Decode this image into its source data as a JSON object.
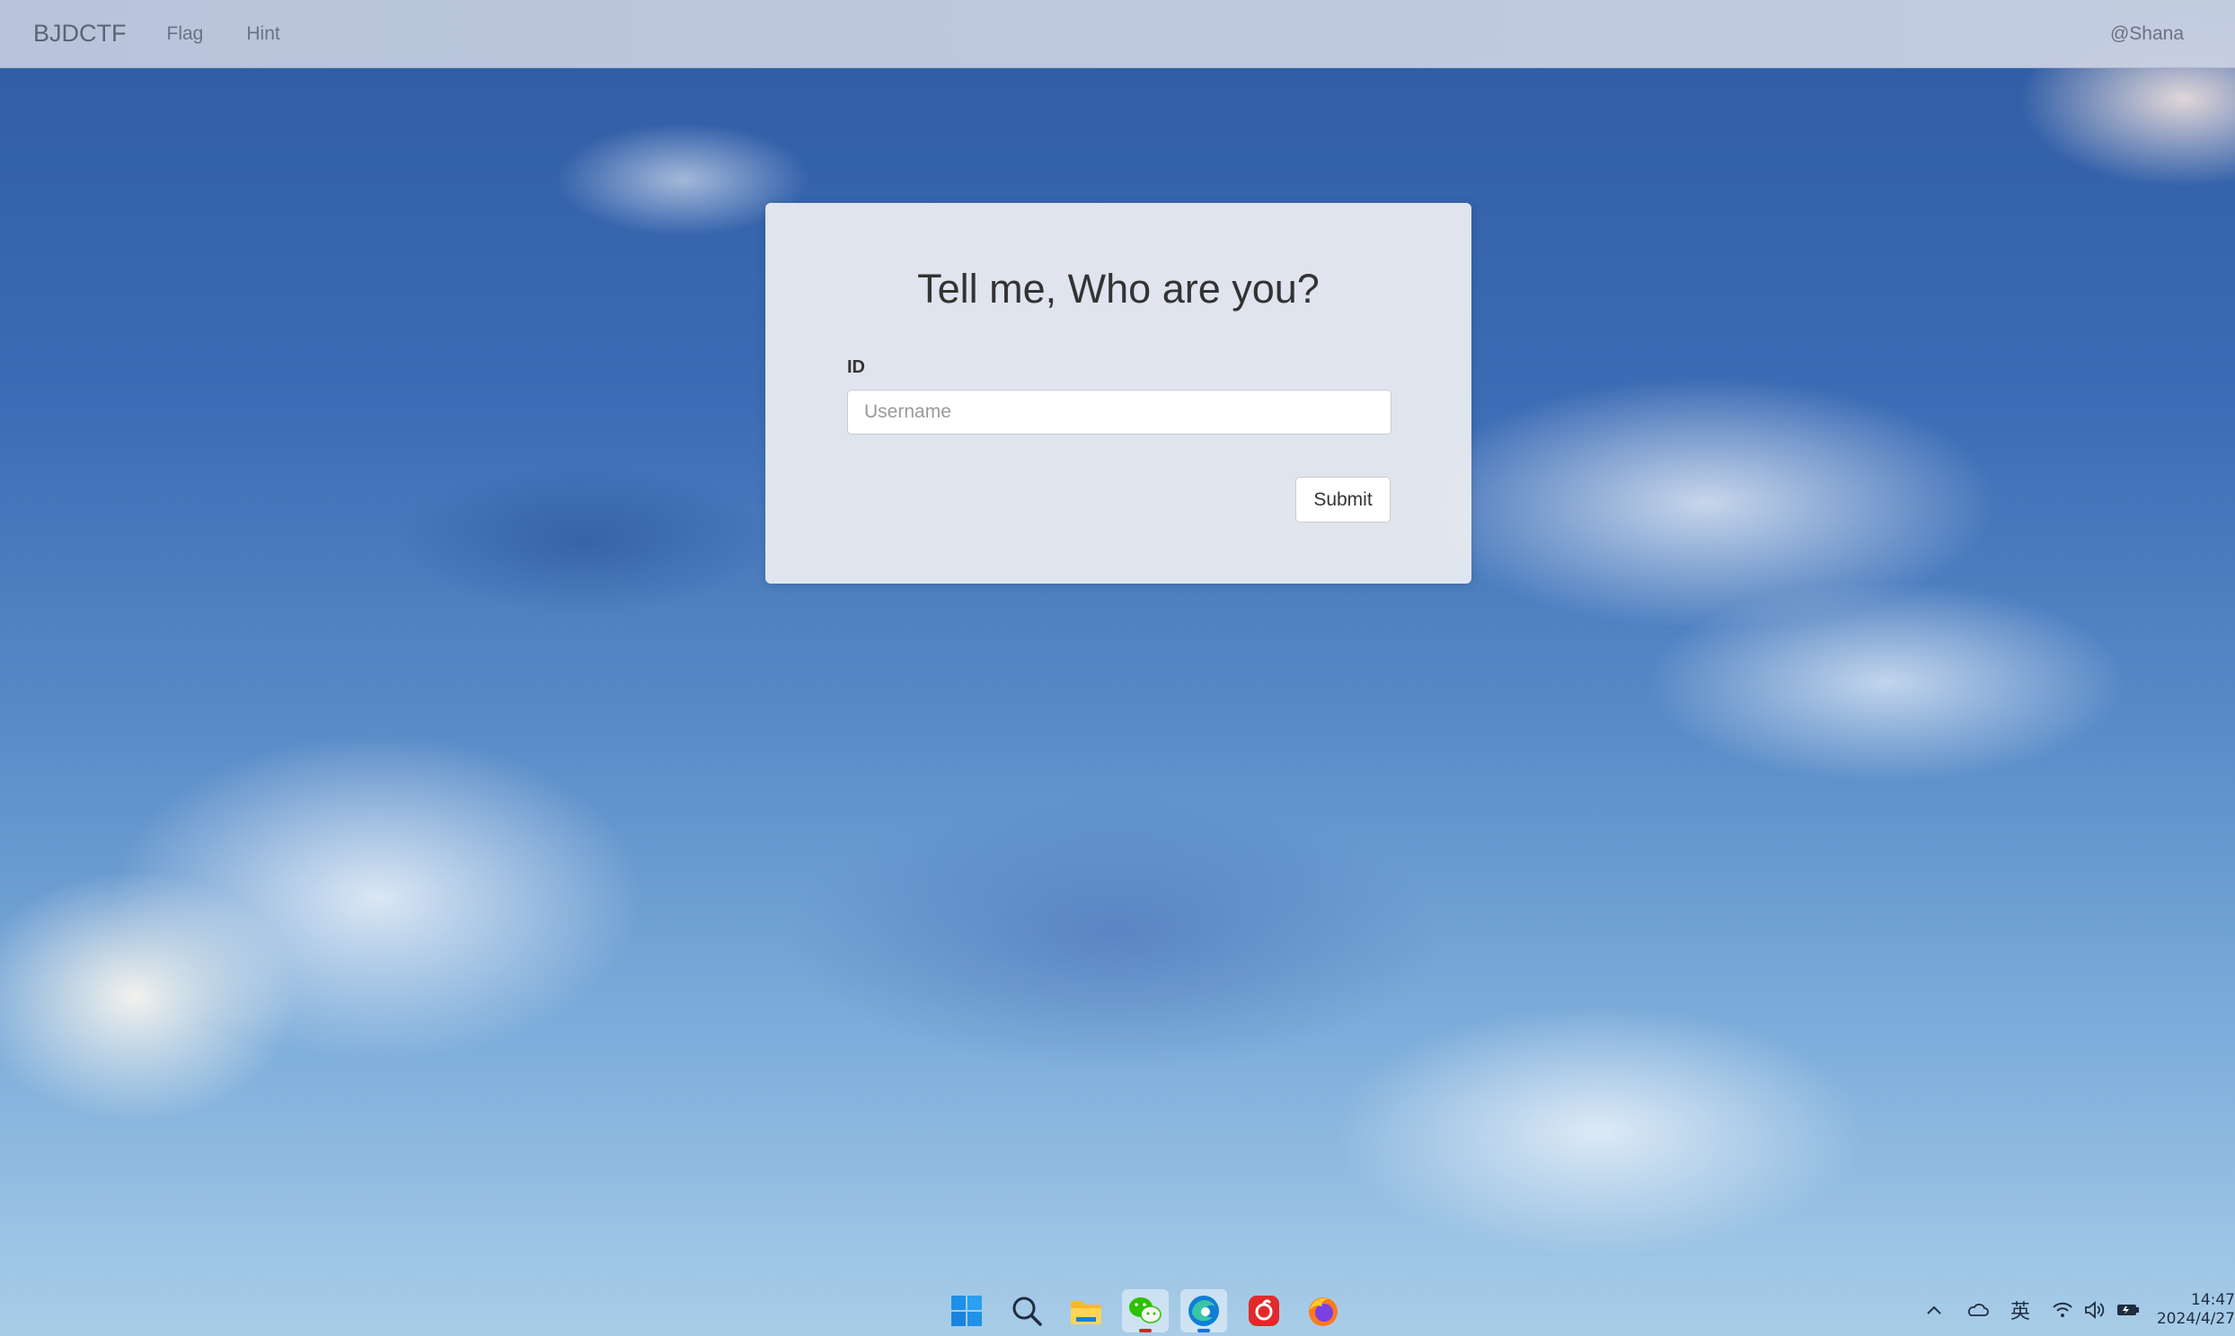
{
  "navbar": {
    "brand": "BJDCTF",
    "links": [
      "Flag",
      "Hint"
    ],
    "user": "@Shana"
  },
  "panel": {
    "title": "Tell me, Who are you?",
    "field_label": "ID",
    "input_placeholder": "Username",
    "input_value": "",
    "submit_label": "Submit"
  },
  "taskbar": {
    "apps": [
      {
        "name": "windows-start-icon"
      },
      {
        "name": "search-icon"
      },
      {
        "name": "file-explorer-icon"
      },
      {
        "name": "wechat-icon",
        "active": true
      },
      {
        "name": "edge-browser-icon",
        "active": true
      },
      {
        "name": "netease-music-icon"
      },
      {
        "name": "firefox-icon"
      }
    ],
    "tray": {
      "ime": "英",
      "time": "14:47",
      "date": "2024/4/27"
    }
  },
  "colors": {
    "navbar": "#c3cbdf",
    "panel": "#eceef2",
    "sky": "#3c6cb5"
  }
}
